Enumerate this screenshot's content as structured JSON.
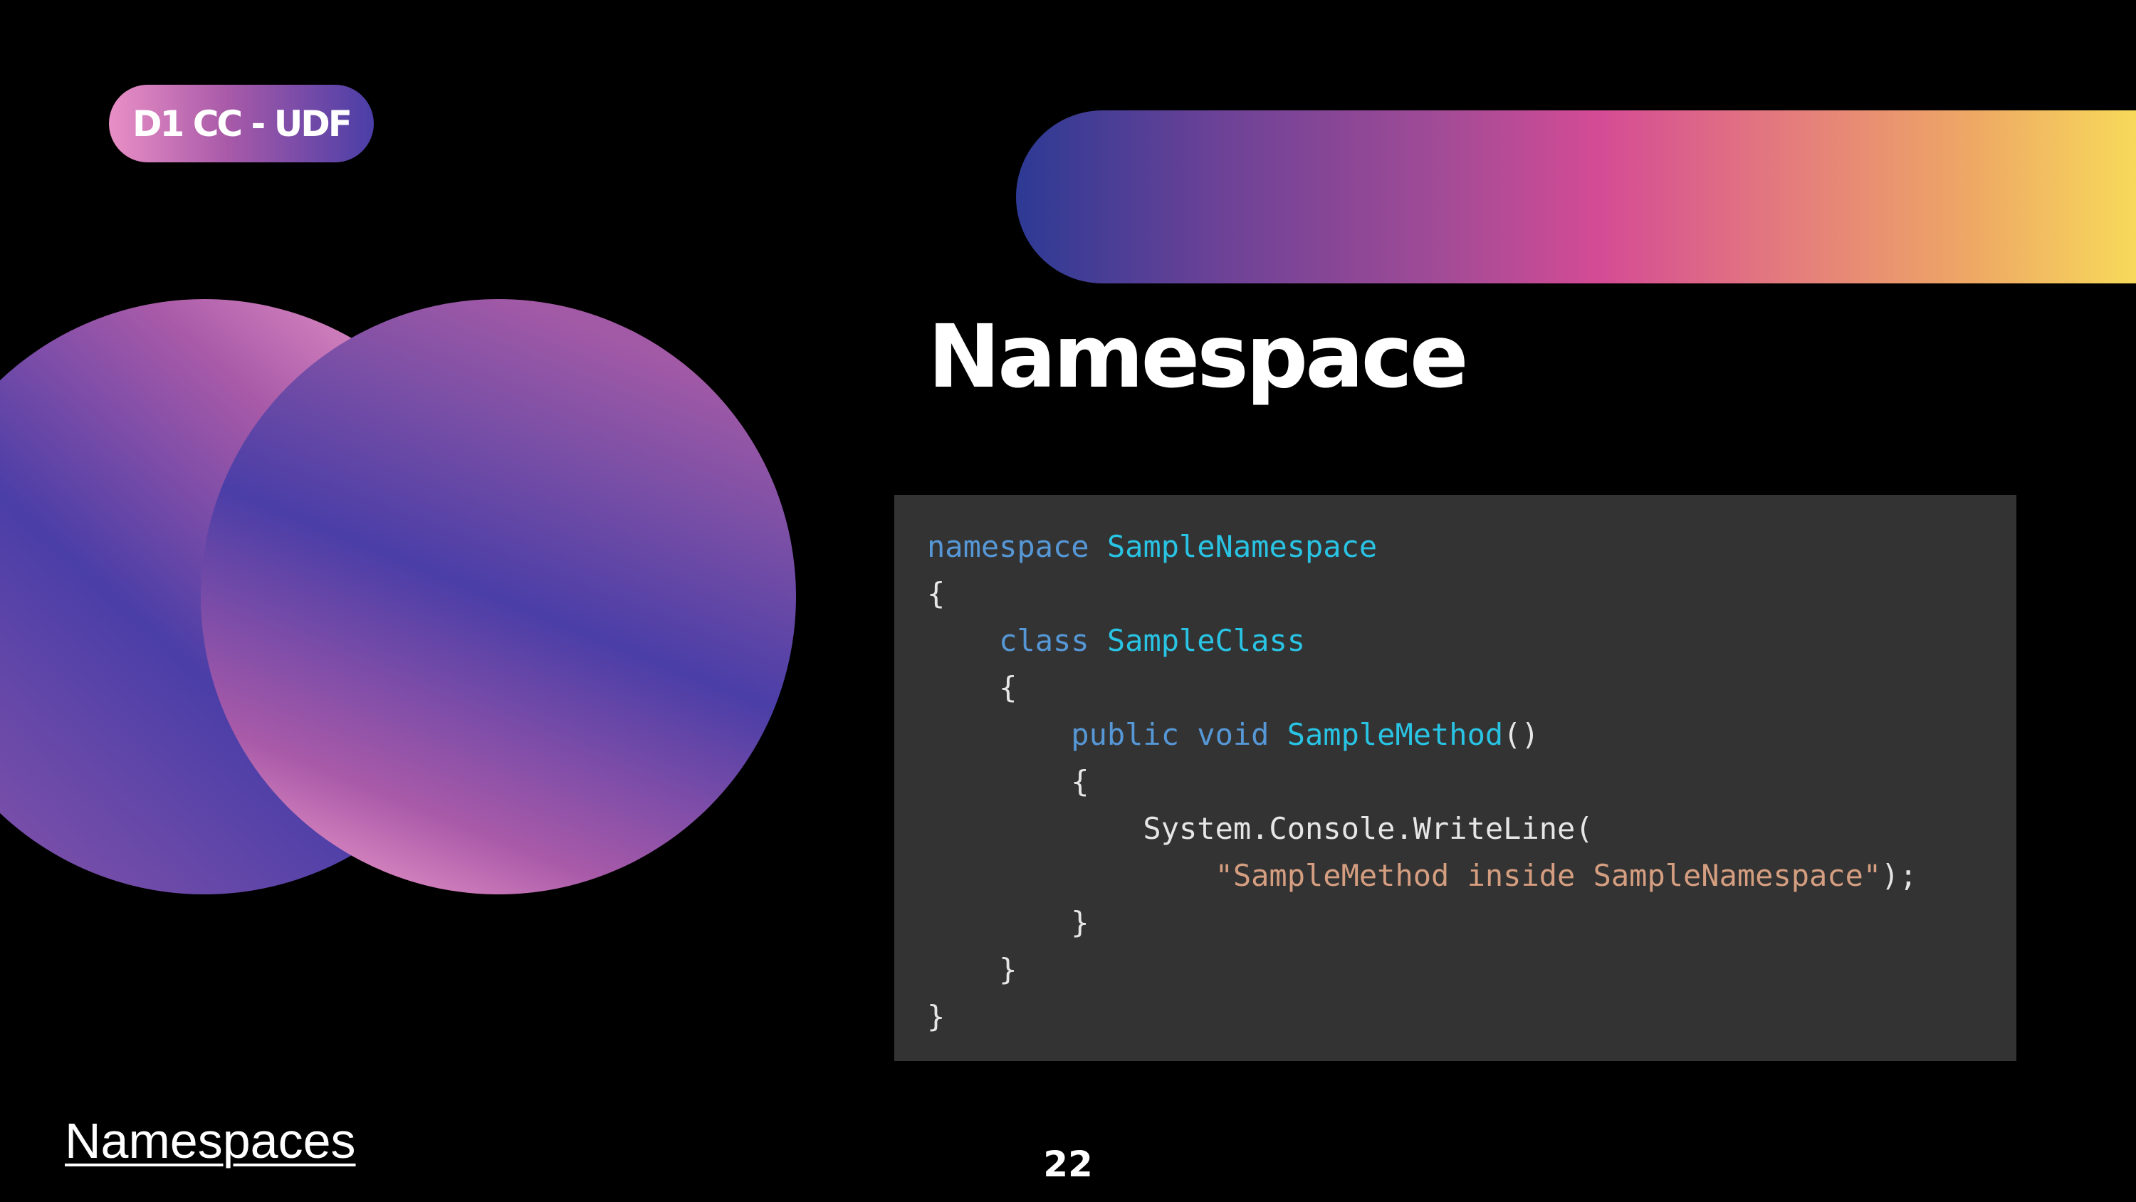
{
  "slide": {
    "tag": "D1 CC - UDF",
    "title": "Namespace",
    "footer_link": "Namespaces",
    "page_number": "22"
  },
  "code": {
    "language": "csharp",
    "lines": [
      [
        {
          "t": "namespace ",
          "c": "kw"
        },
        {
          "t": "SampleNamespace",
          "c": "typ"
        }
      ],
      [
        {
          "t": "{",
          "c": "pl"
        }
      ],
      [
        {
          "t": "    class ",
          "c": "kw"
        },
        {
          "t": "SampleClass",
          "c": "typ"
        }
      ],
      [
        {
          "t": "    {",
          "c": "pl"
        }
      ],
      [
        {
          "t": "        public void ",
          "c": "kw"
        },
        {
          "t": "SampleMethod",
          "c": "typ"
        },
        {
          "t": "()",
          "c": "pl"
        }
      ],
      [
        {
          "t": "        {",
          "c": "pl"
        }
      ],
      [
        {
          "t": "            System.Console.WriteLine(",
          "c": "pl"
        }
      ],
      [
        {
          "t": "                ",
          "c": "pl"
        },
        {
          "t": "\"SampleMethod inside SampleNamespace\"",
          "c": "str"
        },
        {
          "t": ");",
          "c": "pl"
        }
      ],
      [
        {
          "t": "        }",
          "c": "pl"
        }
      ],
      [
        {
          "t": "    }",
          "c": "pl"
        }
      ],
      [
        {
          "t": "}",
          "c": "pl"
        }
      ]
    ]
  },
  "colors": {
    "background": "#000000",
    "code_background": "#333333",
    "keyword": "#5697d6",
    "type_name": "#29c3e3",
    "string": "#d59e80",
    "plain": "#e6e6e6",
    "banner_gradient": [
      "#2d3a94",
      "#d44b95",
      "#f7da5a"
    ],
    "circle_gradient": [
      "#e98fc6",
      "#a85aa8",
      "#4a3ea7"
    ]
  },
  "decorations": {
    "banner": "gradient-bar",
    "circles": "overlapping-gradient-circles"
  }
}
